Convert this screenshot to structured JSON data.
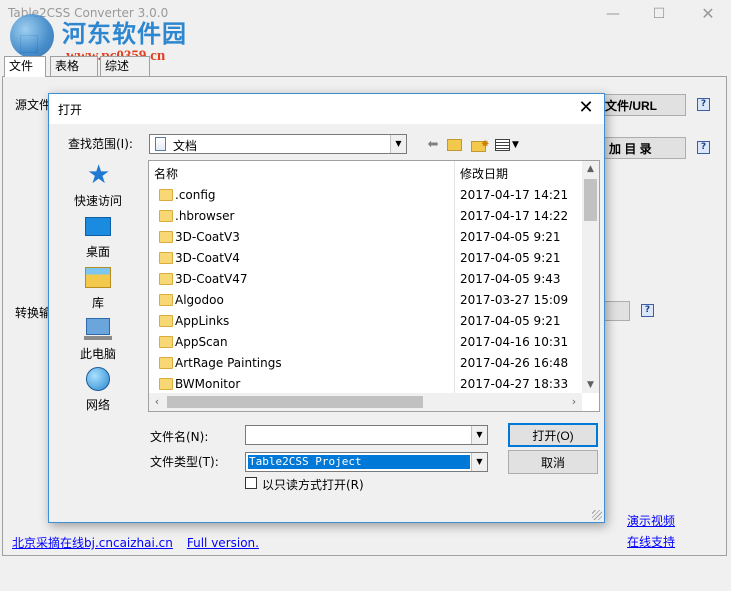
{
  "app": {
    "title": "Table2CSS Converter 3.0.0",
    "tabs": [
      "文件",
      "表格",
      "综述"
    ],
    "source_label": "源文件",
    "convert_label": "转换输",
    "btn_file_url": "文件/URL",
    "btn_add_dir": "加 目 录",
    "help_glyph": "?",
    "footer_link_site": "北京采摘在线bj.cncaizhai.cn",
    "footer_link_full": "Full version.",
    "link_demo": "演示视频",
    "link_support": "在线支持",
    "window_controls": {
      "minimize": "—",
      "maximize": "☐",
      "close": "✕"
    }
  },
  "watermark": {
    "title": "河东软件园",
    "url": "www.pc0359.cn"
  },
  "dialog": {
    "title": "打开",
    "close_glyph": "✕",
    "lookin_label": "查找范围(I):",
    "lookin_value": "文档",
    "places": [
      "快速访问",
      "桌面",
      "库",
      "此电脑",
      "网络"
    ],
    "columns": {
      "name": "名称",
      "modified": "修改日期",
      "sort_glyph": "^"
    },
    "files": [
      {
        "name": ".config",
        "modified": "2017-04-17 14:21"
      },
      {
        "name": ".hbrowser",
        "modified": "2017-04-17 14:22"
      },
      {
        "name": "3D-CoatV3",
        "modified": "2017-04-05 9:21"
      },
      {
        "name": "3D-CoatV4",
        "modified": "2017-04-05 9:21"
      },
      {
        "name": "3D-CoatV47",
        "modified": "2017-04-05 9:43"
      },
      {
        "name": "Algodoo",
        "modified": "2017-03-27 15:09"
      },
      {
        "name": "AppLinks",
        "modified": "2017-04-05 9:21"
      },
      {
        "name": "AppScan",
        "modified": "2017-04-16 10:31"
      },
      {
        "name": "ArtRage Paintings",
        "modified": "2017-04-26 16:48"
      },
      {
        "name": "BWMonitor",
        "modified": "2017-04-27 18:33"
      }
    ],
    "filename_label": "文件名(N):",
    "filename_value": "",
    "filetype_label": "文件类型(T):",
    "filetype_value": "Table2CSS Project",
    "open_button": "打开(O)",
    "cancel_button": "取消",
    "readonly_label": "以只读方式打开(R)",
    "readonly_checked": false
  }
}
